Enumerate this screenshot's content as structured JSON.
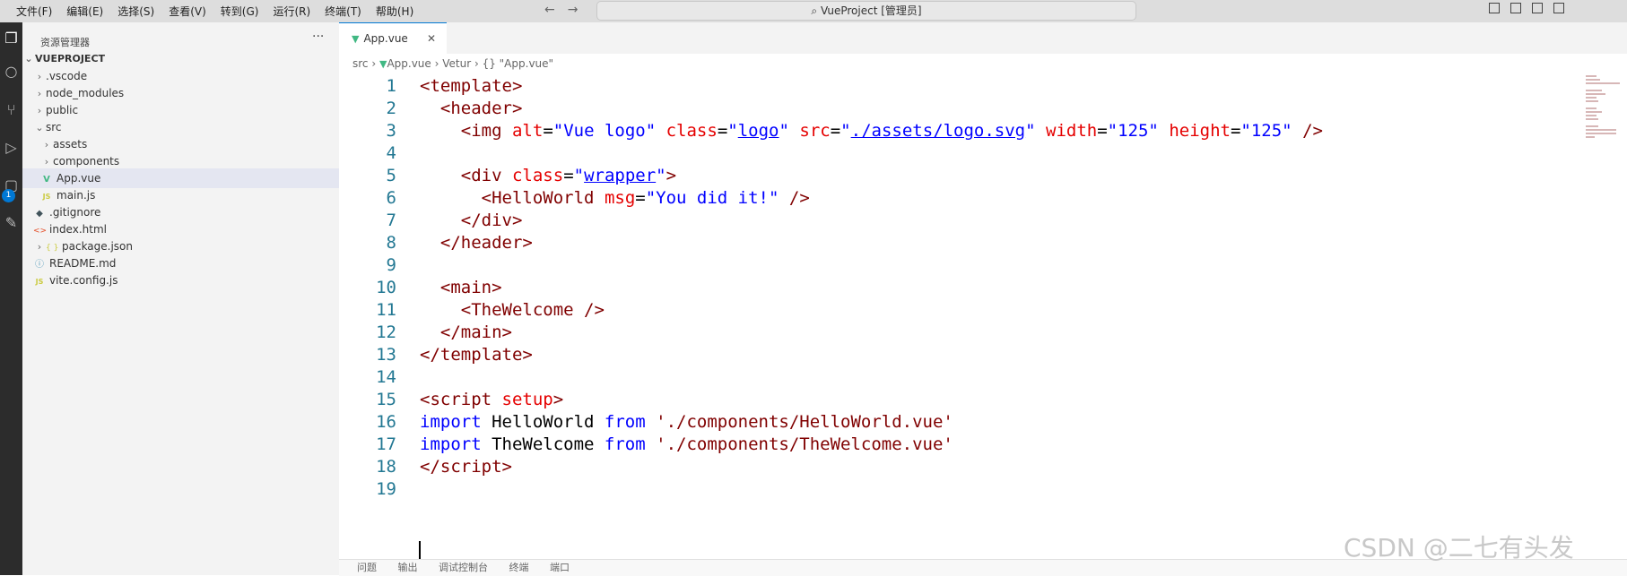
{
  "titlebar": {
    "menu": [
      "文件(F)",
      "编辑(E)",
      "选择(S)",
      "查看(V)",
      "转到(G)",
      "运行(R)",
      "终端(T)",
      "帮助(H)"
    ],
    "command_center": "VueProject [管理员]"
  },
  "activitybar": {
    "badge": "1"
  },
  "sidebar": {
    "title": "资源管理器",
    "more": "···",
    "project": "VUEPROJECT",
    "items": [
      {
        "label": ".vscode",
        "twisty": "›",
        "icon": "",
        "color": "#333"
      },
      {
        "label": "node_modules",
        "twisty": "›",
        "icon": "",
        "color": "#333"
      },
      {
        "label": "public",
        "twisty": "›",
        "icon": "",
        "color": "#333"
      },
      {
        "label": "src",
        "twisty": "⌄",
        "icon": "",
        "color": "#333"
      },
      {
        "label": "assets",
        "twisty": "›",
        "icon": "",
        "color": "#333"
      },
      {
        "label": "components",
        "twisty": "›",
        "icon": "",
        "color": "#333"
      },
      {
        "label": "App.vue",
        "twisty": "",
        "icon": "V",
        "color": "#333"
      },
      {
        "label": "main.js",
        "twisty": "",
        "icon": "JS",
        "color": "#333"
      },
      {
        "label": ".gitignore",
        "twisty": "",
        "icon": "◆",
        "color": "#333"
      },
      {
        "label": "index.html",
        "twisty": "",
        "icon": "<>",
        "color": "#333"
      },
      {
        "label": "package.json",
        "twisty": "›",
        "icon": "{ }",
        "color": "#333"
      },
      {
        "label": "README.md",
        "twisty": "",
        "icon": "ⓘ",
        "color": "#333"
      },
      {
        "label": "vite.config.js",
        "twisty": "",
        "icon": "JS",
        "color": "#333"
      }
    ]
  },
  "editor": {
    "tab_label": "App.vue",
    "tab_close": "✕",
    "breadcrumb": [
      "src",
      "App.vue",
      "Vetur",
      "{} \"App.vue\""
    ],
    "line_numbers": [
      "1",
      "2",
      "3",
      "4",
      "5",
      "6",
      "7",
      "8",
      "9",
      "10",
      "11",
      "12",
      "13",
      "14",
      "15",
      "16",
      "17",
      "18",
      "19"
    ]
  },
  "bottom_panel": [
    "问题",
    "输出",
    "调试控制台",
    "终端",
    "端口"
  ],
  "watermark": "CSDN @二七有头发"
}
